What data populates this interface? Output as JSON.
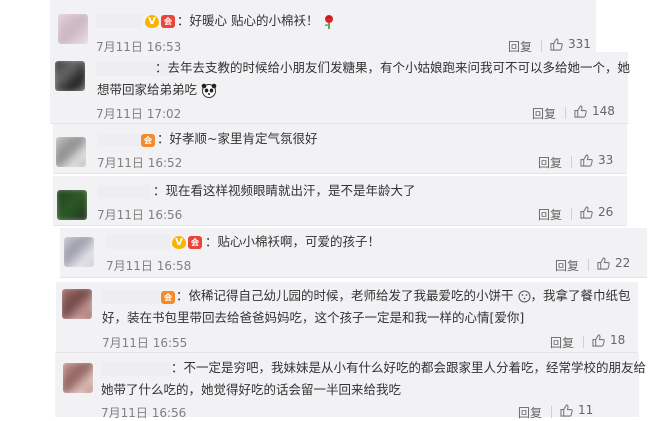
{
  "comments": [
    {
      "text": "好暖心 贴心的小棉袄！",
      "time": "7月11日 16:53",
      "reply": "回复",
      "likes": "331",
      "badge_v": "V",
      "badge_vip": "会"
    },
    {
      "text_line1": "去年去支教的时候给小朋友们发糖果，有个小姑娘跑来问我可不可以多给她一个，她",
      "text_line2": "想带回家给弟弟吃",
      "time": "7月11日 17:02",
      "reply": "回复",
      "likes": "148"
    },
    {
      "text": "好孝顺~家里肯定气氛很好",
      "time": "7月11日 16:52",
      "reply": "回复",
      "likes": "33",
      "badge_vip": "会"
    },
    {
      "text": "现在看这样视频眼睛就出汗，是不是年龄大了",
      "time": "7月11日 16:56",
      "reply": "回复",
      "likes": "26"
    },
    {
      "text": "贴心小棉袄啊，可爱的孩子！",
      "time": "7月11日 16:58",
      "reply": "回复",
      "likes": "22",
      "badge_v": "V",
      "badge_vip": "会"
    },
    {
      "text_line1": "依稀记得自己幼儿园的时候，老师给发了我最爱吃的小饼干",
      "text_line1b": "，我拿了餐巾纸包",
      "text_line2": "好，装在书包里带回去给爸爸妈妈吃，这个孩子一定是和我一样的心情[爱你]",
      "time": "7月11日 16:55",
      "reply": "回复",
      "likes": "18",
      "badge_vip": "会"
    },
    {
      "text_line1": "不一定是穷吧，我妹妹是从小有什么好吃的都会跟家里人分着吃，经常学校的朋友给",
      "text_line2": "她带了什么吃的，她觉得好吃的话会留一半回来给我吃",
      "time": "7月11日 16:56",
      "reply": "回复",
      "likes": "11"
    }
  ],
  "colors": {
    "card_bg": "#f2f2f5",
    "vip_orange": "#f58a2c",
    "v_gold": "#f7b500"
  }
}
